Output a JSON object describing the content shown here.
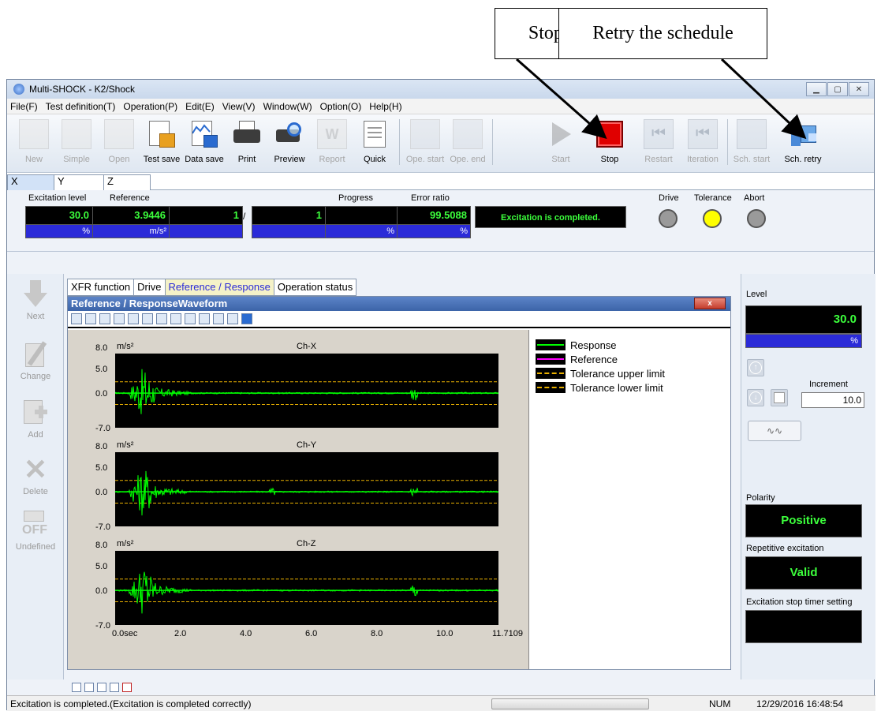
{
  "callouts": {
    "stop": "Stop the schedule",
    "retry": "Retry the schedule"
  },
  "window": {
    "title": "Multi-SHOCK - K2/Shock"
  },
  "menu": [
    "File(F)",
    "Test definition(T)",
    "Operation(P)",
    "Edit(E)",
    "View(V)",
    "Window(W)",
    "Option(O)",
    "Help(H)"
  ],
  "toolbar": {
    "new": "New",
    "simple": "Simple",
    "open": "Open",
    "test_save": "Test save",
    "data_save": "Data save",
    "print": "Print",
    "preview": "Preview",
    "report": "Report",
    "quick": "Quick",
    "ope_start": "Ope. start",
    "ope_end": "Ope. end",
    "start": "Start",
    "stop": "Stop",
    "restart": "Restart",
    "iteration": "Iteration",
    "sch_start": "Sch. start",
    "sch_retry": "Sch. retry"
  },
  "axis_tabs": [
    "X",
    "Y",
    "Z"
  ],
  "status": {
    "excitation_level_label": "Excitation level",
    "excitation_level": "30.0",
    "excitation_level_unit": "%",
    "reference_label": "Reference",
    "reference": "3.9446",
    "reference_unit": "m/s²",
    "count_a": "1",
    "slash": "/",
    "count_b": "1",
    "progress_label": "Progress",
    "progress_unit": "%",
    "error_ratio_label": "Error ratio",
    "error_ratio": "99.5088",
    "error_ratio_unit": "%",
    "message": "Excitation is completed.",
    "drive_label": "Drive",
    "tolerance_label": "Tolerance",
    "abort_label": "Abort",
    "lamp_colors": {
      "drive": "#9a9a9a",
      "tolerance": "#ffff00",
      "abort": "#9a9a9a"
    }
  },
  "left_panel": [
    "Next",
    "Change",
    "Add",
    "Delete",
    "Undefined"
  ],
  "panel_tabs": [
    "XFR function",
    "Drive",
    "Reference / Response",
    "Operation status"
  ],
  "subwindow": {
    "title": "Reference / ResponseWaveform",
    "close": "x"
  },
  "plot": {
    "unit": "m/s²",
    "channels": [
      "Ch-X",
      "Ch-Y",
      "Ch-Z"
    ],
    "y_ticks": [
      "8.0",
      "5.0",
      "0.0",
      "-7.0"
    ],
    "x_ticks": [
      "0.0sec",
      "2.0",
      "4.0",
      "6.0",
      "8.0",
      "10.0",
      "11.7109"
    ]
  },
  "legend": [
    {
      "name": "Response",
      "color": "#00ff00"
    },
    {
      "name": "Reference",
      "color": "#ff00ff"
    },
    {
      "name": "Tolerance upper limit",
      "color": "#e8b000"
    },
    {
      "name": "Tolerance lower limit",
      "color": "#e8b000"
    }
  ],
  "right_panel": {
    "level_label": "Level",
    "level": "30.0",
    "level_unit": "%",
    "increment_label": "Increment",
    "increment": "10.0",
    "polarity_label": "Polarity",
    "polarity": "Positive",
    "repetitive_label": "Repetitive excitation",
    "repetitive": "Valid",
    "stop_timer_label": "Excitation stop timer setting",
    "stop_timer": ""
  },
  "statusbar": {
    "message": "Excitation is completed.(Excitation is completed correctly)",
    "num": "NUM",
    "datetime": "12/29/2016  16:48:54"
  }
}
